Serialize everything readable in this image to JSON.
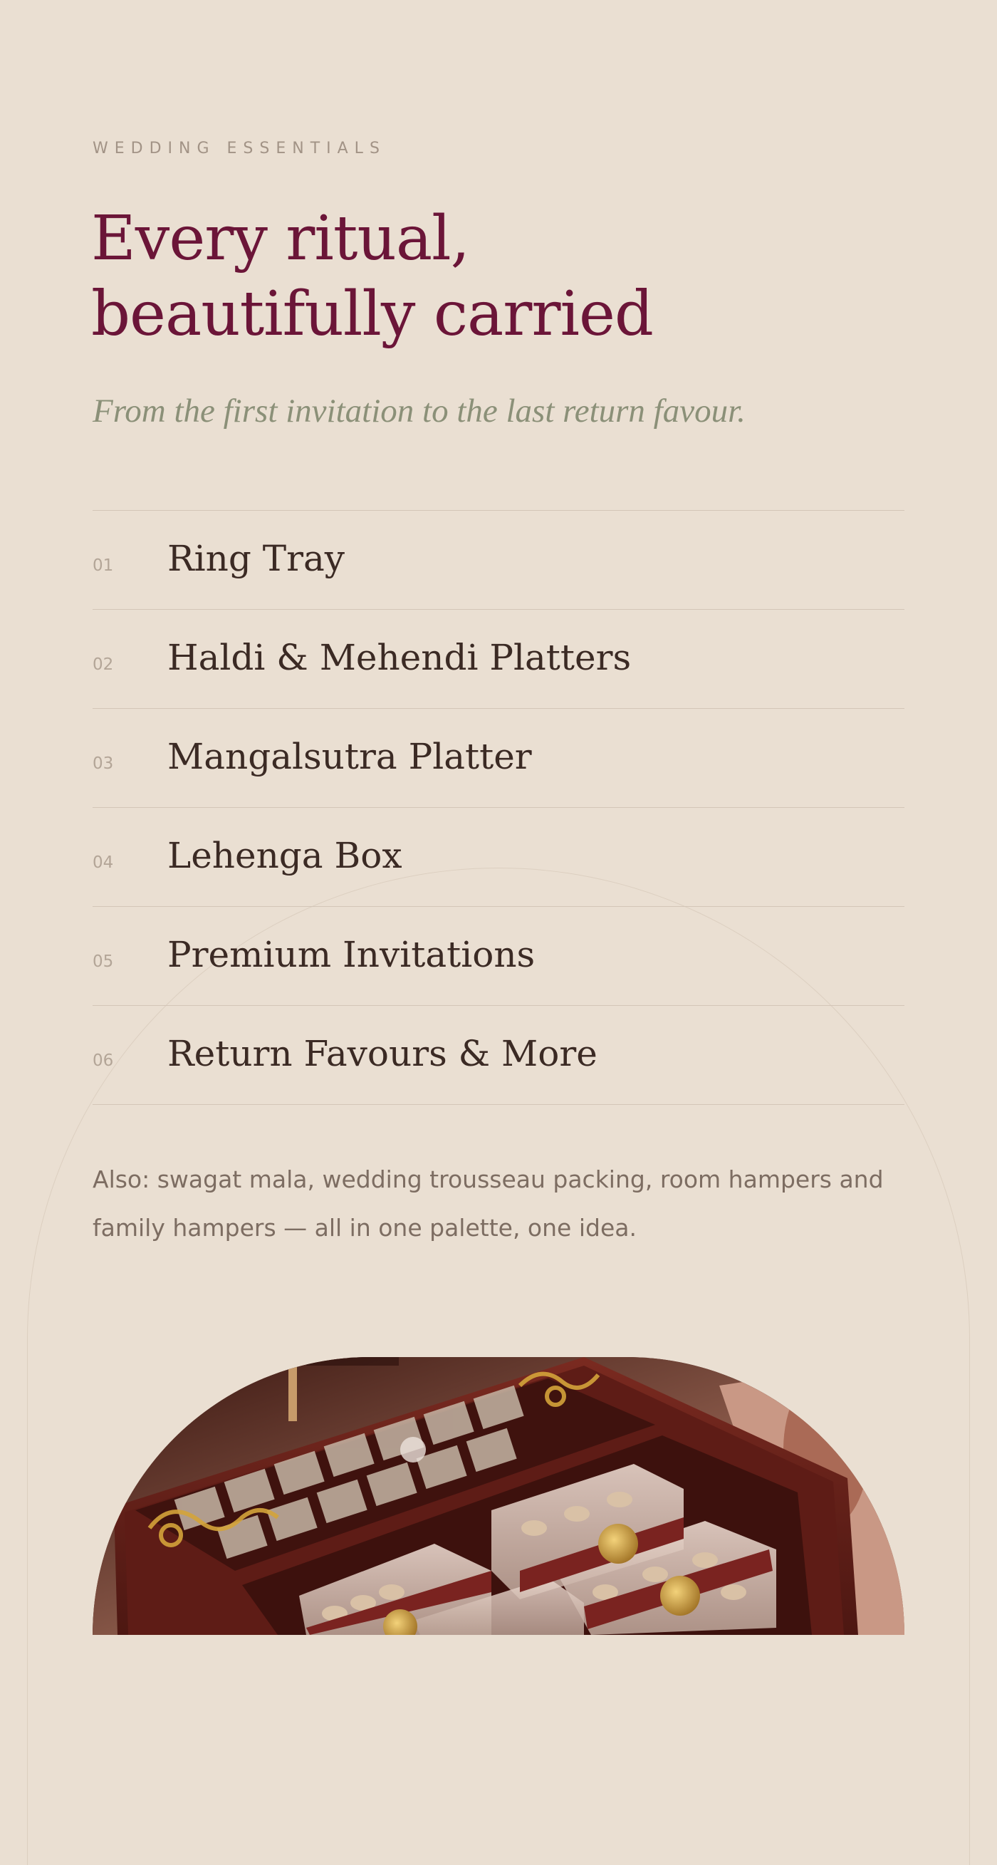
{
  "header": {
    "eyebrow": "WEDDING ESSENTIALS",
    "headline_line1": "Every ritual,",
    "headline_line2": "beautifully carried",
    "tagline": "From the first invitation to the last return favour."
  },
  "items": [
    {
      "number": "01",
      "label": "Ring Tray"
    },
    {
      "number": "02",
      "label": "Haldi & Mehendi Platters"
    },
    {
      "number": "03",
      "label": "Mangalsutra Platter"
    },
    {
      "number": "04",
      "label": "Lehenga Box"
    },
    {
      "number": "05",
      "label": "Premium Invitations"
    },
    {
      "number": "06",
      "label": "Return Favours & More"
    }
  ],
  "note": "Also: swagat mala, wedding trousseau packing, room hampers and family hampers — all in one palette, one idea.",
  "colors": {
    "background": "#eadfd2",
    "headline": "#6b1538",
    "tagline": "#8b9078",
    "item_text": "#3b2a24",
    "muted": "#a29386",
    "divider": "#d3c5b7"
  }
}
